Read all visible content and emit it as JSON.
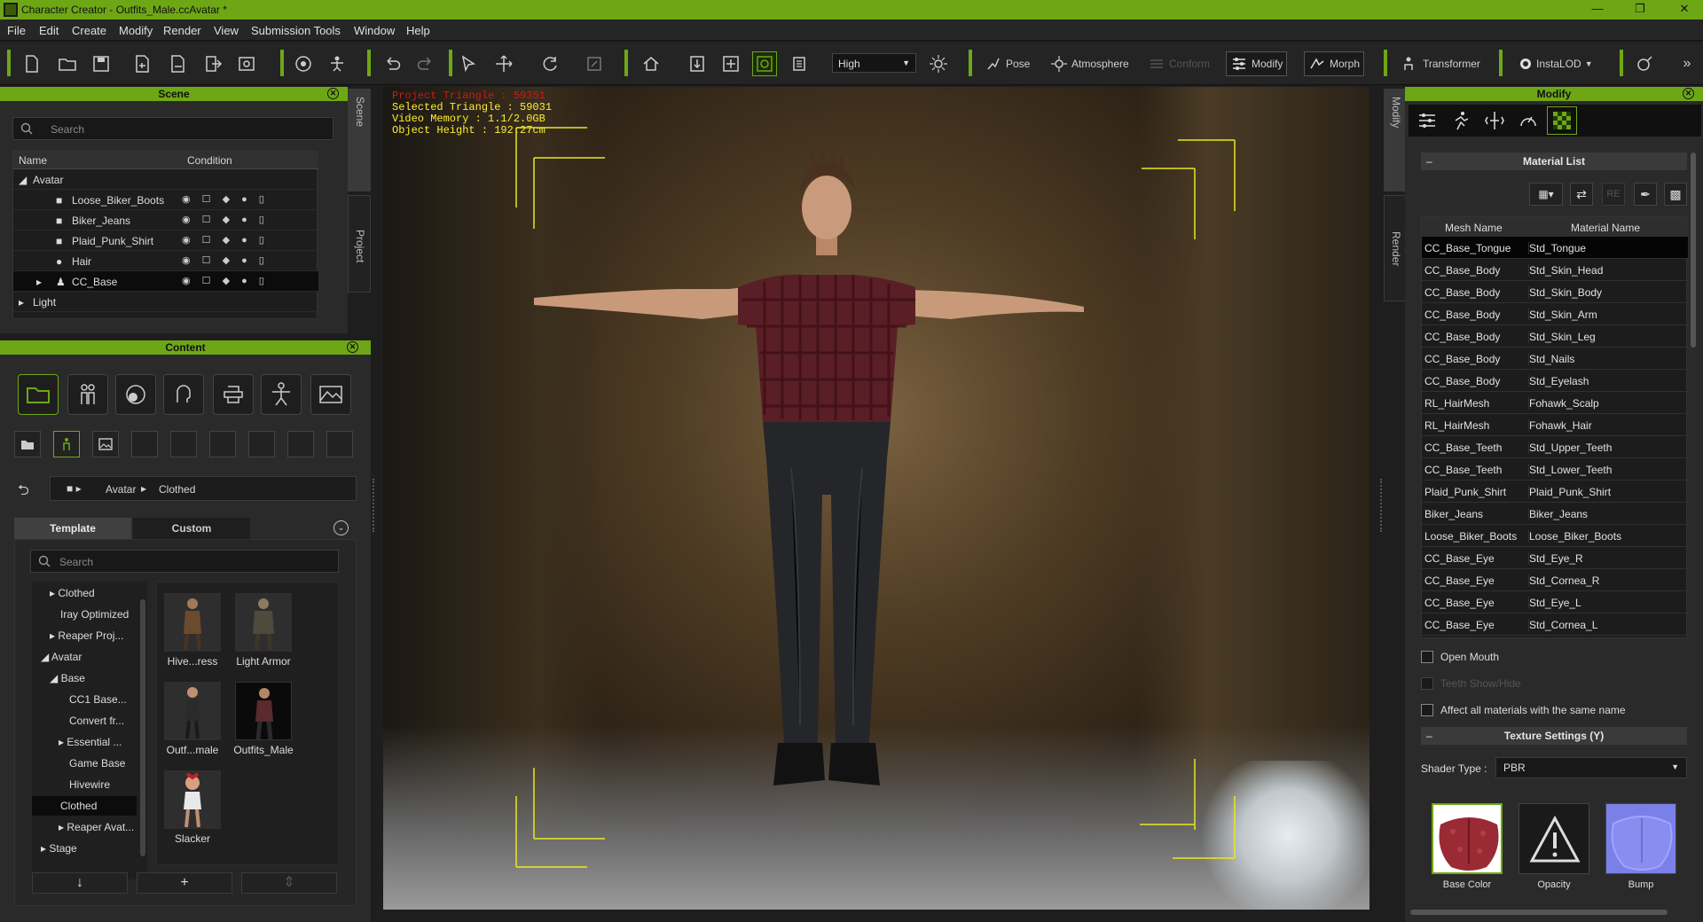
{
  "window": {
    "title": "Character Creator - Outfits_Male.ccAvatar *"
  },
  "menu": [
    "File",
    "Edit",
    "Create",
    "Modify",
    "Render",
    "View",
    "Submission Tools",
    "Window",
    "Help"
  ],
  "toolbar": {
    "quality": "High",
    "pose_label": "Pose",
    "atmosphere_label": "Atmosphere",
    "conform_label": "Conform",
    "modify_label": "Modify",
    "morph_label": "Morph",
    "transformer_label": "Transformer",
    "instalod_label": "InstaLOD"
  },
  "scene": {
    "title": "Scene",
    "search_placeholder": "Search",
    "col_name": "Name",
    "col_condition": "Condition",
    "rows": [
      {
        "label": "Avatar"
      },
      {
        "label": "Loose_Biker_Boots"
      },
      {
        "label": "Biker_Jeans"
      },
      {
        "label": "Plaid_Punk_Shirt"
      },
      {
        "label": "Hair"
      },
      {
        "label": "CC_Base"
      },
      {
        "label": "Light"
      }
    ],
    "side_tab_scene": "Scene",
    "side_tab_project": "Project"
  },
  "content": {
    "title": "Content",
    "breadcrumb": [
      "Avatar",
      "Clothed"
    ],
    "tab_template": "Template",
    "tab_custom": "Custom",
    "search_placeholder": "Search",
    "folders": [
      "Clothed",
      "Iray Optimized",
      "Reaper Proj...",
      "Avatar",
      "Base",
      "CC1 Base...",
      "Convert fr...",
      "Essential ...",
      "Game Base",
      "Hivewire",
      "Clothed",
      "Reaper Avat...",
      "Stage"
    ],
    "thumbs": [
      "Hive...ress",
      "Light Armor",
      "Outf...male",
      "Outfits_Male",
      "Slacker"
    ]
  },
  "viewport": {
    "project_triangle": "Project Triangle : 59351",
    "selected_triangle": "Selected Triangle : 59031",
    "video_memory": "Video Memory : 1.1/2.0GB",
    "object_height": "Object Height : 192.27cm"
  },
  "modify": {
    "title": "Modify",
    "material_list_title": "Material List",
    "col_mesh": "Mesh Name",
    "col_material": "Material Name",
    "rows": [
      [
        "CC_Base_Tongue",
        "Std_Tongue"
      ],
      [
        "CC_Base_Body",
        "Std_Skin_Head"
      ],
      [
        "CC_Base_Body",
        "Std_Skin_Body"
      ],
      [
        "CC_Base_Body",
        "Std_Skin_Arm"
      ],
      [
        "CC_Base_Body",
        "Std_Skin_Leg"
      ],
      [
        "CC_Base_Body",
        "Std_Nails"
      ],
      [
        "CC_Base_Body",
        "Std_Eyelash"
      ],
      [
        "RL_HairMesh",
        "Fohawk_Scalp"
      ],
      [
        "RL_HairMesh",
        "Fohawk_Hair"
      ],
      [
        "CC_Base_Teeth",
        "Std_Upper_Teeth"
      ],
      [
        "CC_Base_Teeth",
        "Std_Lower_Teeth"
      ],
      [
        "Plaid_Punk_Shirt",
        "Plaid_Punk_Shirt"
      ],
      [
        "Biker_Jeans",
        "Biker_Jeans"
      ],
      [
        "Loose_Biker_Boots",
        "Loose_Biker_Boots"
      ],
      [
        "CC_Base_Eye",
        "Std_Eye_R"
      ],
      [
        "CC_Base_Eye",
        "Std_Cornea_R"
      ],
      [
        "CC_Base_Eye",
        "Std_Eye_L"
      ],
      [
        "CC_Base_Eye",
        "Std_Cornea_L"
      ]
    ],
    "open_mouth": "Open Mouth",
    "teeth_show_hide": "Teeth Show/Hide",
    "affect_all": "Affect all materials with the same name",
    "texture_settings": "Texture Settings  (Y)",
    "shader_type_label": "Shader Type :",
    "shader_type": "PBR",
    "textures": [
      "Base Color",
      "Opacity",
      "Bump"
    ],
    "side_tab_modify": "Modify",
    "side_tab_render": "Render"
  }
}
